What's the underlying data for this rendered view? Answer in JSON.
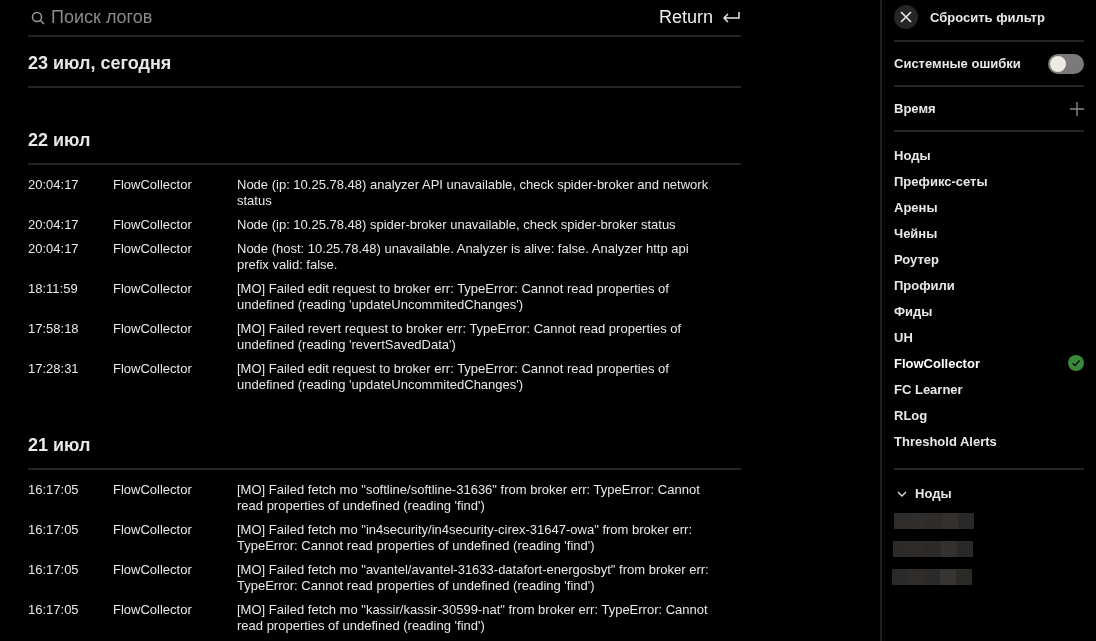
{
  "search": {
    "placeholder": "Поиск логов"
  },
  "return_button": {
    "label": "Return"
  },
  "log_groups": [
    {
      "date": "23 июл, сегодня"
    },
    {
      "date": "22 июл",
      "rows": [
        {
          "time": "20:04:17",
          "source": "FlowCollector",
          "message": "Node (ip: 10.25.78.48) analyzer API unavailable, check spider-broker and network status"
        },
        {
          "time": "20:04:17",
          "source": "FlowCollector",
          "message": "Node (ip: 10.25.78.48) spider-broker unavailable, check spider-broker status"
        },
        {
          "time": "20:04:17",
          "source": "FlowCollector",
          "message": "Node (host: 10.25.78.48) unavailable. Analyzer is alive: false. Analyzer http api prefix valid: false."
        },
        {
          "time": "18:11:59",
          "source": "FlowCollector",
          "message": "[MO] Failed edit request to broker err: TypeError: Cannot read properties of undefined (reading 'updateUncommitedChanges')"
        },
        {
          "time": "17:58:18",
          "source": "FlowCollector",
          "message": "[MO] Failed revert request to broker err: TypeError: Cannot read properties of undefined (reading 'revertSavedData')"
        },
        {
          "time": "17:28:31",
          "source": "FlowCollector",
          "message": "[MO] Failed edit request to broker err: TypeError: Cannot read properties of undefined (reading 'updateUncommitedChanges')"
        }
      ]
    },
    {
      "date": "21 июл",
      "rows": [
        {
          "time": "16:17:05",
          "source": "FlowCollector",
          "message": "[MO] Failed fetch mo \"softline/softline-31636\" from broker err: TypeError: Cannot read properties of undefined (reading 'find')"
        },
        {
          "time": "16:17:05",
          "source": "FlowCollector",
          "message": "[MO] Failed fetch mo \"in4security/in4security-cirex-31647-owa\" from broker err: TypeError: Cannot read properties of undefined (reading 'find')"
        },
        {
          "time": "16:17:05",
          "source": "FlowCollector",
          "message": "[MO] Failed fetch mo \"avantel/avantel-31633-datafort-energosbyt\" from broker err: TypeError: Cannot read properties of undefined (reading 'find')"
        },
        {
          "time": "16:17:05",
          "source": "FlowCollector",
          "message": "[MO] Failed fetch mo \"kassir/kassir-30599-nat\" from broker err: TypeError: Cannot read properties of undefined (reading 'find')"
        }
      ]
    }
  ],
  "sidebar": {
    "reset_button": {
      "label": "Сбросить фильтр"
    },
    "system_errors": {
      "label": "Системные ошибки",
      "on": false
    },
    "time_filter": {
      "label": "Время"
    },
    "sources": [
      {
        "label": "Ноды",
        "selected": false
      },
      {
        "label": "Префикс-сеты",
        "selected": false
      },
      {
        "label": "Арены",
        "selected": false
      },
      {
        "label": "Чейны",
        "selected": false
      },
      {
        "label": "Роутер",
        "selected": false
      },
      {
        "label": "Профили",
        "selected": false
      },
      {
        "label": "Фиды",
        "selected": false
      },
      {
        "label": "UH",
        "selected": false
      },
      {
        "label": "FlowCollector",
        "selected": true
      },
      {
        "label": "FC Learner",
        "selected": false
      },
      {
        "label": "RLog",
        "selected": false
      },
      {
        "label": "Threshold Alerts",
        "selected": false
      }
    ],
    "nodes_section": {
      "label": "Ноды",
      "expanded": true,
      "items": [
        {
          "kind": "redacted"
        },
        {
          "kind": "redacted"
        },
        {
          "kind": "redacted"
        }
      ]
    }
  }
}
